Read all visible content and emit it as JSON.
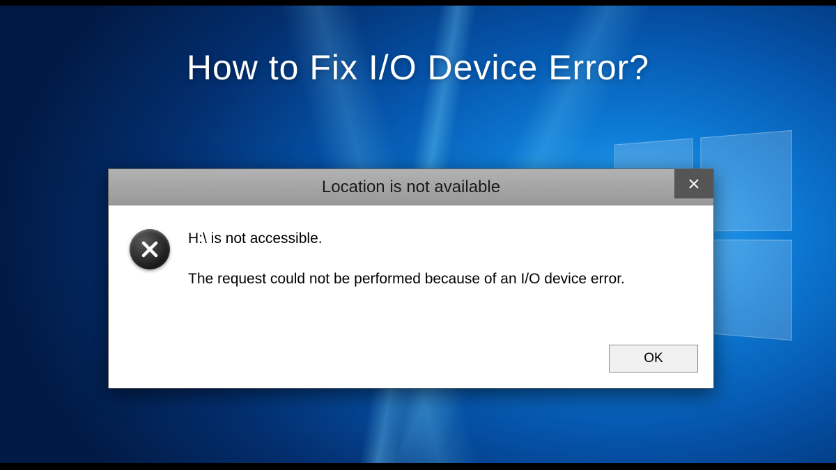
{
  "heading": "How to Fix I/O Device Error?",
  "dialog": {
    "title": "Location is not available",
    "message_line1": "H:\\ is not accessible.",
    "message_line2": "The request could not be performed because of an I/O device error.",
    "ok_label": "OK",
    "close_label": "Close"
  }
}
